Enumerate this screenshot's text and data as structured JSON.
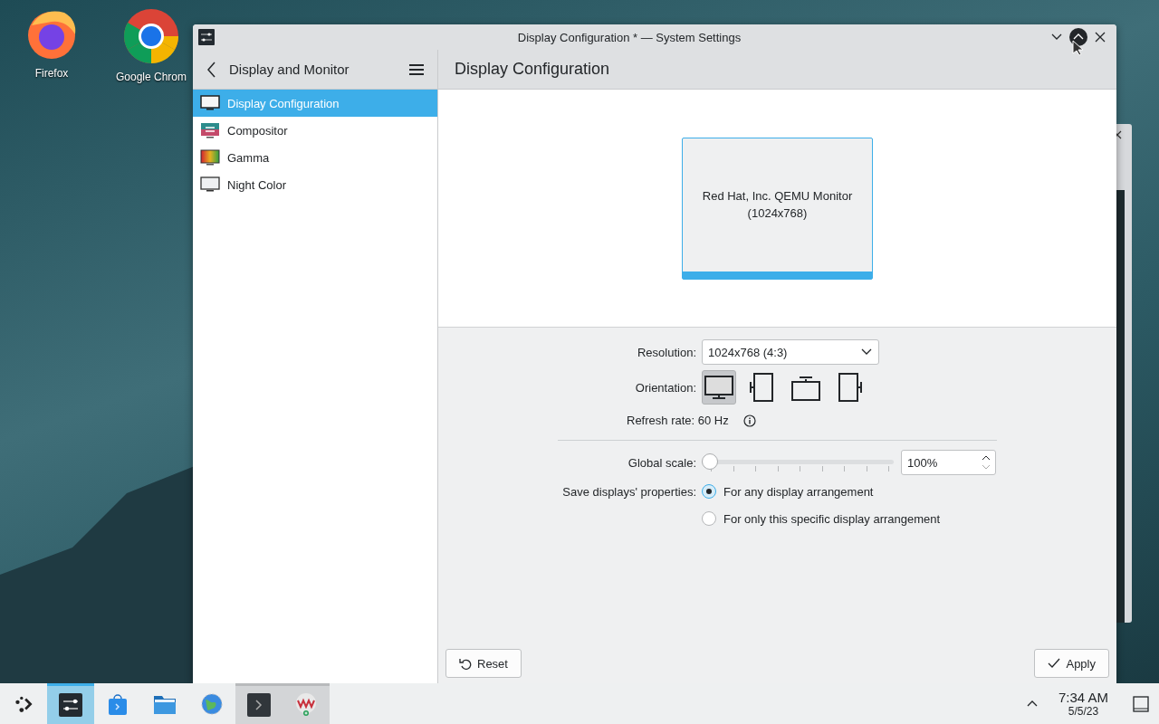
{
  "desktop_icons": [
    {
      "kind": "firefox",
      "label": "Firefox"
    },
    {
      "kind": "chrome",
      "label": "Google Chrom"
    }
  ],
  "window": {
    "title": "Display Configuration * — System Settings"
  },
  "sidebar": {
    "title": "Display and Monitor",
    "items": [
      {
        "kind": "display",
        "label": "Display Configuration",
        "selected": true
      },
      {
        "kind": "compositor",
        "label": "Compositor",
        "selected": false
      },
      {
        "kind": "gamma",
        "label": "Gamma",
        "selected": false
      },
      {
        "kind": "night",
        "label": "Night Color",
        "selected": false
      }
    ]
  },
  "page": {
    "title": "Display Configuration",
    "monitor": {
      "name": "Red Hat, Inc. QEMU Monitor",
      "resolution": "(1024x768)"
    },
    "resolution": {
      "label": "Resolution:",
      "value": "1024x768 (4:3)"
    },
    "orientation": {
      "label": "Orientation:",
      "options": [
        {
          "kind": "landscape",
          "selected": true
        },
        {
          "kind": "portrait-left",
          "selected": false
        },
        {
          "kind": "flipped",
          "selected": false
        },
        {
          "kind": "portrait-right",
          "selected": false
        }
      ]
    },
    "refresh_rate": {
      "label": "Refresh rate:",
      "value": "60 Hz"
    },
    "global_scale": {
      "label": "Global scale:",
      "level": 0,
      "value": "100%"
    },
    "save_properties": {
      "label": "Save displays' properties:",
      "options": [
        {
          "label": "For any display arrangement",
          "selected": true
        },
        {
          "label": "For only this specific display arrangement",
          "selected": false
        }
      ]
    },
    "buttons": [
      {
        "kind": "reset",
        "label": "Reset"
      },
      {
        "kind": "apply",
        "label": "Apply"
      }
    ]
  },
  "taskbar": {
    "items": [
      {
        "kind": "launcher",
        "selected": false,
        "open": false
      },
      {
        "kind": "settings",
        "selected": true,
        "open": true
      },
      {
        "kind": "discover",
        "selected": false,
        "open": false
      },
      {
        "kind": "files",
        "selected": false,
        "open": false
      },
      {
        "kind": "browser",
        "selected": false,
        "open": false
      },
      {
        "kind": "terminal",
        "selected": false,
        "open": true
      },
      {
        "kind": "vm",
        "selected": false,
        "open": true
      }
    ],
    "time": "7:34 AM",
    "date": "5/5/23"
  }
}
